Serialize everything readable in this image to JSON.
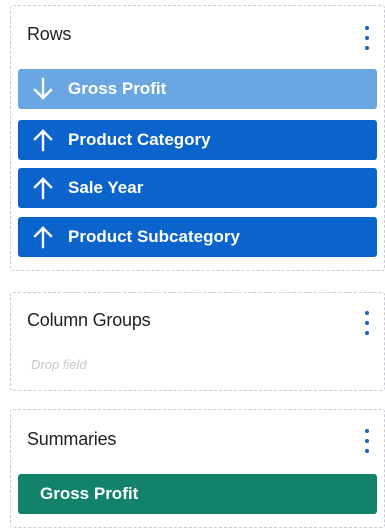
{
  "rows": {
    "title": "Rows",
    "fields": [
      {
        "label": "Gross Profit",
        "sort": "descending",
        "icon": "arrow-down-icon",
        "color": "#6aa6e2"
      },
      {
        "label": "Product Category",
        "sort": "ascending",
        "icon": "arrow-up-icon",
        "color": "#0b63cc"
      },
      {
        "label": "Sale Year",
        "sort": "ascending",
        "icon": "arrow-up-icon",
        "color": "#0b63cc"
      },
      {
        "label": "Product Subcategory",
        "sort": "ascending",
        "icon": "arrow-up-icon",
        "color": "#0b63cc"
      }
    ]
  },
  "column_groups": {
    "title": "Column Groups",
    "placeholder": "Drop field"
  },
  "summaries": {
    "title": "Summaries",
    "fields": [
      {
        "label": "Gross Profit",
        "color": "#12826a"
      }
    ]
  },
  "menu_icon": "more-vertical-icon",
  "accent_color": "#1565c0"
}
